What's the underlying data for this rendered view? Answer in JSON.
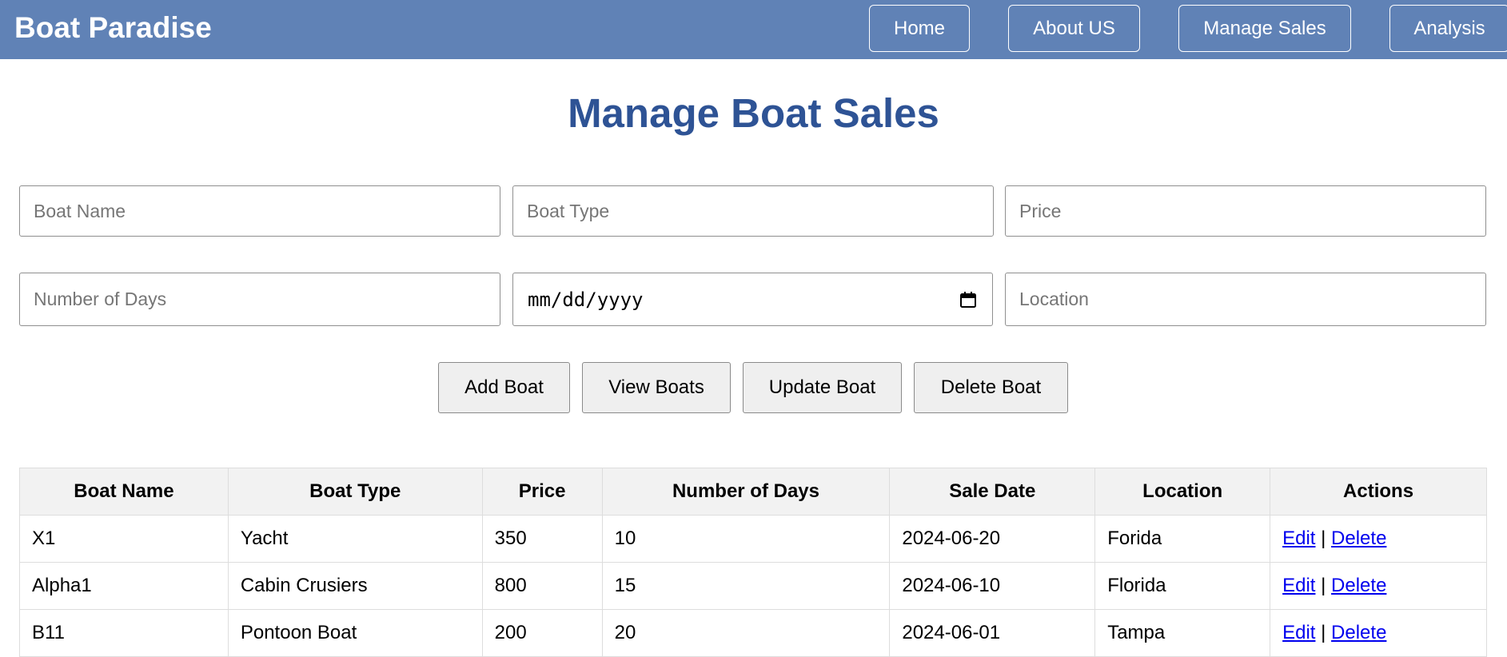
{
  "header": {
    "brand": "Boat Paradise",
    "nav": {
      "home": "Home",
      "about": "About US",
      "manage_sales": "Manage Sales",
      "analysis": "Analysis"
    }
  },
  "page_title": "Manage Boat Sales",
  "form": {
    "boat_name_placeholder": "Boat Name",
    "boat_type_placeholder": "Boat Type",
    "price_placeholder": "Price",
    "days_placeholder": "Number of Days",
    "date_value": "mm/dd/yyyy",
    "location_placeholder": "Location"
  },
  "actions": {
    "add": "Add Boat",
    "view": "View Boats",
    "update": "Update Boat",
    "delete": "Delete Boat"
  },
  "table": {
    "headers": [
      "Boat Name",
      "Boat Type",
      "Price",
      "Number of Days",
      "Sale Date",
      "Location",
      "Actions"
    ],
    "rows": [
      {
        "name": "X1",
        "type": "Yacht",
        "price": "350",
        "days": "10",
        "date": "2024-06-20",
        "location": "Forida",
        "edit": "Edit",
        "sep": "|",
        "delete": "Delete"
      },
      {
        "name": "Alpha1",
        "type": "Cabin Crusiers",
        "price": "800",
        "days": "15",
        "date": "2024-06-10",
        "location": "Florida",
        "edit": "Edit",
        "sep": "|",
        "delete": "Delete"
      },
      {
        "name": "B11",
        "type": "Pontoon Boat",
        "price": "200",
        "days": "20",
        "date": "2024-06-01",
        "location": "Tampa",
        "edit": "Edit",
        "sep": "|",
        "delete": "Delete"
      }
    ]
  },
  "colors": {
    "navbar": "#6082b6",
    "title": "#2e5395",
    "link": "#0000ee"
  },
  "icons": {
    "date_picker": "calendar-icon"
  }
}
